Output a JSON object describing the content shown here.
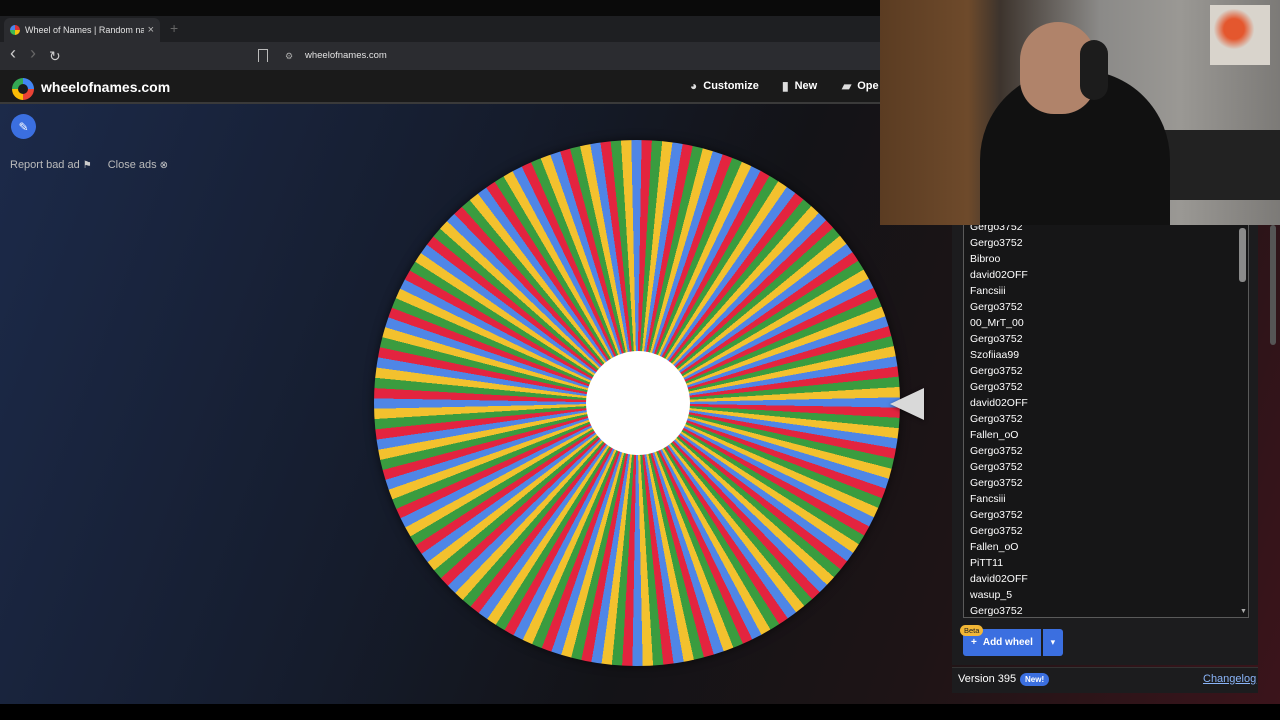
{
  "browser": {
    "tab_title": "Wheel of Names | Random nam",
    "tab_close": "×",
    "new_tab": "+",
    "back": "‹",
    "forward": "›",
    "reload": "↻",
    "url": "wheelofnames.com"
  },
  "header": {
    "site_name": "wheelofnames.com",
    "menu": [
      {
        "label": "Customize",
        "icon": "palette-icon"
      },
      {
        "label": "New",
        "icon": "file-icon"
      },
      {
        "label": "Ope",
        "icon": "folder-icon"
      }
    ]
  },
  "ads": {
    "report_label": "Report bad ad",
    "close_label": "Close ads"
  },
  "entries": [
    "Gergo3752",
    "Gergo3752",
    "Bibroo",
    "david02OFF",
    "Fancsiii",
    "Gergo3752",
    "00_MrT_00",
    "Gergo3752",
    "Szofiiaa99",
    "Gergo3752",
    "Gergo3752",
    "david02OFF",
    "Gergo3752",
    "Fallen_oO",
    "Gergo3752",
    "Gergo3752",
    "Gergo3752",
    "Fancsiii",
    "Gergo3752",
    "Gergo3752",
    "Fallen_oO",
    "PiTT11",
    "david02OFF",
    "wasup_5",
    "Gergo3752"
  ],
  "add_wheel": {
    "beta_label": "Beta",
    "label": "Add wheel",
    "plus": "+",
    "caret": "▾"
  },
  "footer": {
    "version": "Version 395",
    "new_badge": "New!",
    "changelog": "Changelog"
  },
  "colors": {
    "wheel_red": "#e3243f",
    "wheel_green": "#3a9c3f",
    "wheel_yellow": "#f3c12e",
    "wheel_blue": "#4f86e6",
    "accent": "#3b6fe0"
  }
}
